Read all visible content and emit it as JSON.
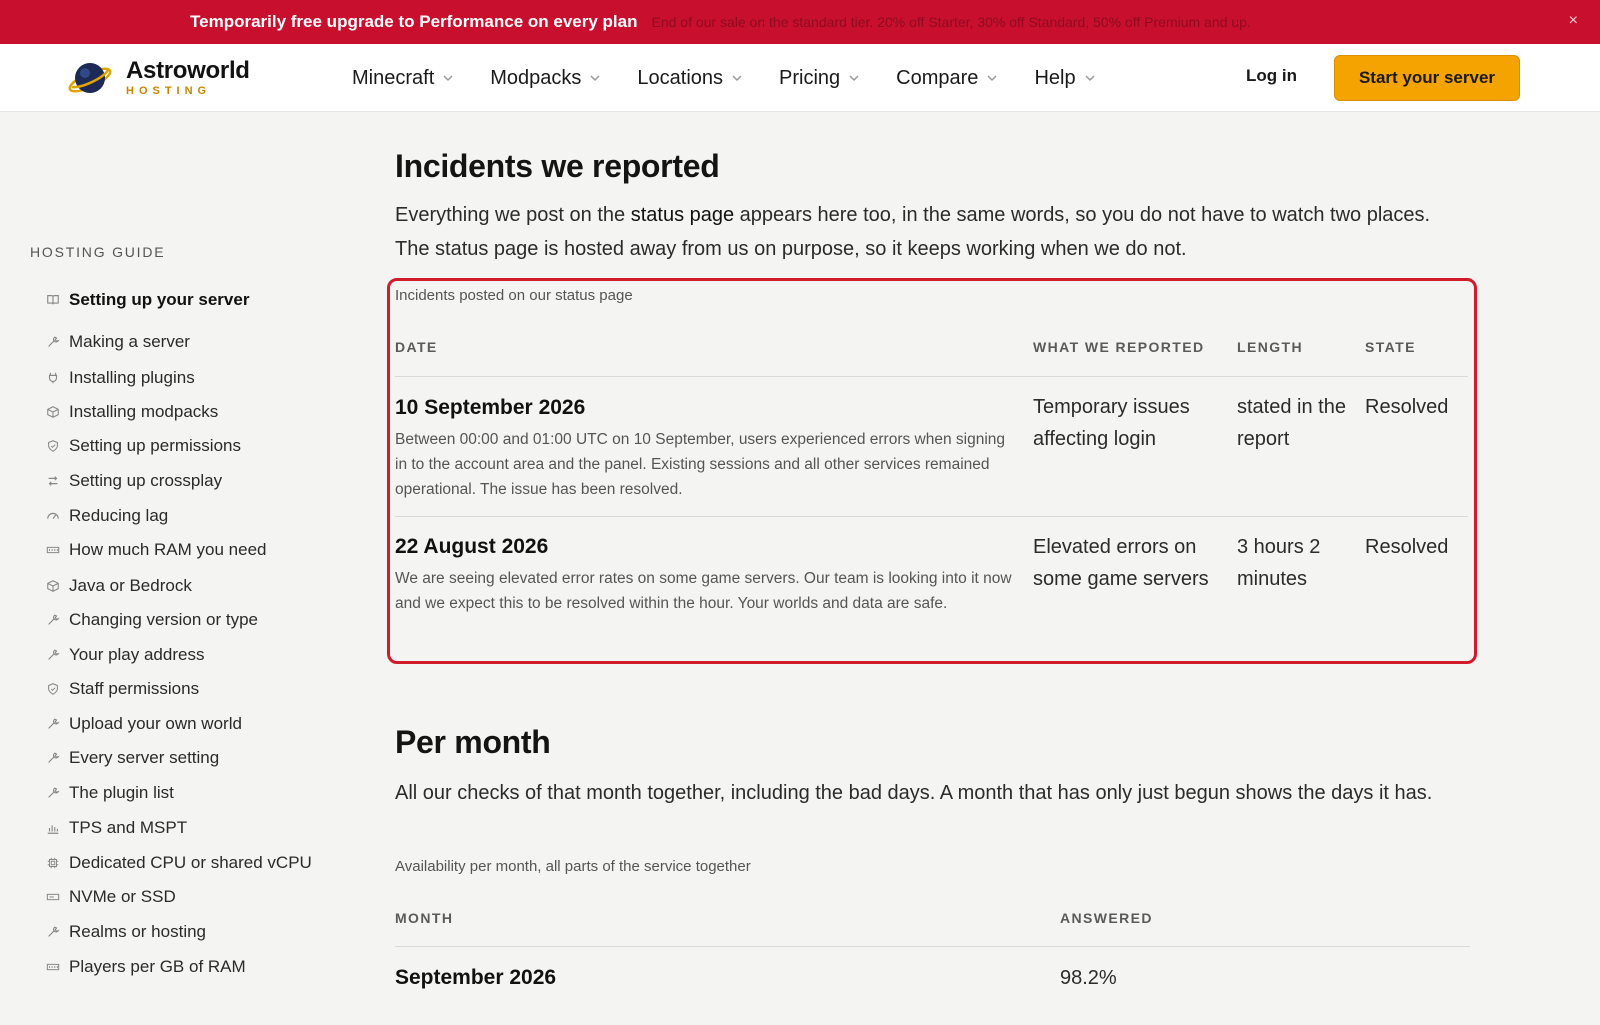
{
  "banner": {
    "headline": "Temporarily free upgrade to Performance on every plan",
    "subtext": "End of our sale on the standard tier. 20% off Starter, 30% off Standard, 50% off Premium and up.",
    "close_glyph": "×"
  },
  "header": {
    "logo_name": "Astroworld",
    "logo_tag": "HOSTING",
    "nav": [
      "Minecraft",
      "Modpacks",
      "Locations",
      "Pricing",
      "Compare",
      "Help"
    ],
    "login": "Log in",
    "cta": "Start your server"
  },
  "sidebar": {
    "heading": "HOSTING GUIDE",
    "items": [
      {
        "label": "Setting up your server",
        "icon": "book-icon",
        "active": true
      },
      {
        "label": "Making a server",
        "icon": "wrench-icon"
      },
      {
        "label": "Installing plugins",
        "icon": "plug-icon"
      },
      {
        "label": "Installing modpacks",
        "icon": "cube-icon"
      },
      {
        "label": "Setting up permissions",
        "icon": "shield-icon"
      },
      {
        "label": "Setting up crossplay",
        "icon": "swap-icon"
      },
      {
        "label": "Reducing lag",
        "icon": "gauge-icon"
      },
      {
        "label": "How much RAM you need",
        "icon": "memory-icon"
      },
      {
        "label": "Java or Bedrock",
        "icon": "cube-icon"
      },
      {
        "label": "Changing version or type",
        "icon": "wrench-icon"
      },
      {
        "label": "Your play address",
        "icon": "wrench-icon"
      },
      {
        "label": "Staff permissions",
        "icon": "shield-icon"
      },
      {
        "label": "Upload your own world",
        "icon": "wrench-icon"
      },
      {
        "label": "Every server setting",
        "icon": "wrench-icon"
      },
      {
        "label": "The plugin list",
        "icon": "wrench-icon"
      },
      {
        "label": "TPS and MSPT",
        "icon": "bar-chart-icon"
      },
      {
        "label": "Dedicated CPU or shared vCPU",
        "icon": "cpu-icon"
      },
      {
        "label": "NVMe or SSD",
        "icon": "drive-icon"
      },
      {
        "label": "Realms or hosting",
        "icon": "wrench-icon"
      },
      {
        "label": "Players per GB of RAM",
        "icon": "memory-icon"
      }
    ]
  },
  "incidents": {
    "title": "Incidents we reported",
    "lead_before": "Everything we post on the ",
    "lead_link": "status page",
    "lead_after": " appears here too, in the same words, so you do not have to watch two places. The status page is hosted away from us on purpose, so it keeps working when we do not.",
    "caption": "Incidents posted on our status page",
    "columns": [
      "DATE",
      "WHAT WE REPORTED",
      "LENGTH",
      "STATE"
    ],
    "rows": [
      {
        "date": "10 September 2026",
        "description": "Between 00:00 and 01:00 UTC on 10 September, users experienced errors when signing in to the account area and the panel. Existing sessions and all other services remained operational. The issue has been resolved.",
        "reported": "Temporary issues affecting login",
        "length": "stated in the report",
        "state": "Resolved"
      },
      {
        "date": "22 August 2026",
        "description": "We are seeing elevated error rates on some game servers. Our team is looking into it now and we expect this to be resolved within the hour. Your worlds and data are safe.",
        "reported": "Elevated errors on some game servers",
        "length": "3 hours 2 minutes",
        "state": "Resolved"
      }
    ]
  },
  "per_month": {
    "title": "Per month",
    "lead": "All our checks of that month together, including the bad days. A month that has only just begun shows the days it has.",
    "caption": "Availability per month, all parts of the service together",
    "columns": [
      "MONTH",
      "ANSWERED"
    ],
    "rows": [
      {
        "month": "September 2026",
        "answered": "98.2%"
      }
    ]
  },
  "colors": {
    "banner": "#c8102e",
    "cta": "#f5a300",
    "highlight_border": "#d11a2a",
    "logo_tag": "#c88500"
  }
}
